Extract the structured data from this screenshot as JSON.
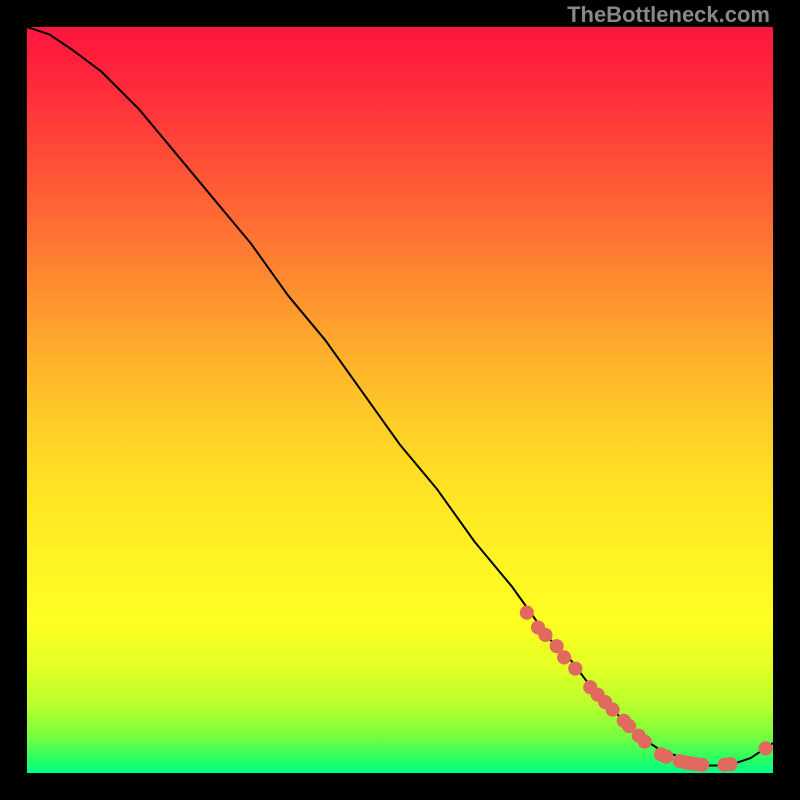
{
  "watermark": "TheBottleneck.com",
  "chart_data": {
    "type": "line",
    "title": "",
    "xlabel": "",
    "ylabel": "",
    "xlim": [
      0,
      100
    ],
    "ylim": [
      0,
      100
    ],
    "grid": false,
    "series": [
      {
        "name": "bottleneck-curve",
        "color": "#000000",
        "x": [
          0,
          3,
          6,
          10,
          15,
          20,
          25,
          30,
          35,
          40,
          45,
          50,
          55,
          60,
          65,
          70,
          73,
          76,
          79,
          82,
          85,
          88,
          91,
          94,
          97,
          100
        ],
        "y": [
          100,
          99,
          97,
          94,
          89,
          83,
          77,
          71,
          64,
          58,
          51,
          44,
          38,
          31,
          25,
          18,
          15,
          11,
          8,
          5,
          3,
          2,
          1,
          1,
          2,
          4
        ]
      }
    ],
    "markers": {
      "name": "data-points",
      "color": "#e06a5d",
      "radius_plot_units": 0.95,
      "points": [
        {
          "x": 67.0,
          "y": 21.5
        },
        {
          "x": 68.5,
          "y": 19.5
        },
        {
          "x": 69.5,
          "y": 18.5
        },
        {
          "x": 71.0,
          "y": 17.0
        },
        {
          "x": 72.0,
          "y": 15.5
        },
        {
          "x": 73.5,
          "y": 14.0
        },
        {
          "x": 75.5,
          "y": 11.5
        },
        {
          "x": 76.5,
          "y": 10.5
        },
        {
          "x": 77.5,
          "y": 9.5
        },
        {
          "x": 78.5,
          "y": 8.5
        },
        {
          "x": 80.0,
          "y": 7.0
        },
        {
          "x": 80.7,
          "y": 6.3
        },
        {
          "x": 82.0,
          "y": 5.0
        },
        {
          "x": 82.8,
          "y": 4.2
        },
        {
          "x": 85.0,
          "y": 2.5
        },
        {
          "x": 85.7,
          "y": 2.2
        },
        {
          "x": 87.5,
          "y": 1.6
        },
        {
          "x": 88.3,
          "y": 1.4
        },
        {
          "x": 89.0,
          "y": 1.3
        },
        {
          "x": 89.7,
          "y": 1.2
        },
        {
          "x": 90.5,
          "y": 1.1
        },
        {
          "x": 93.5,
          "y": 1.1
        },
        {
          "x": 94.3,
          "y": 1.2
        },
        {
          "x": 99.0,
          "y": 3.3
        }
      ]
    }
  }
}
